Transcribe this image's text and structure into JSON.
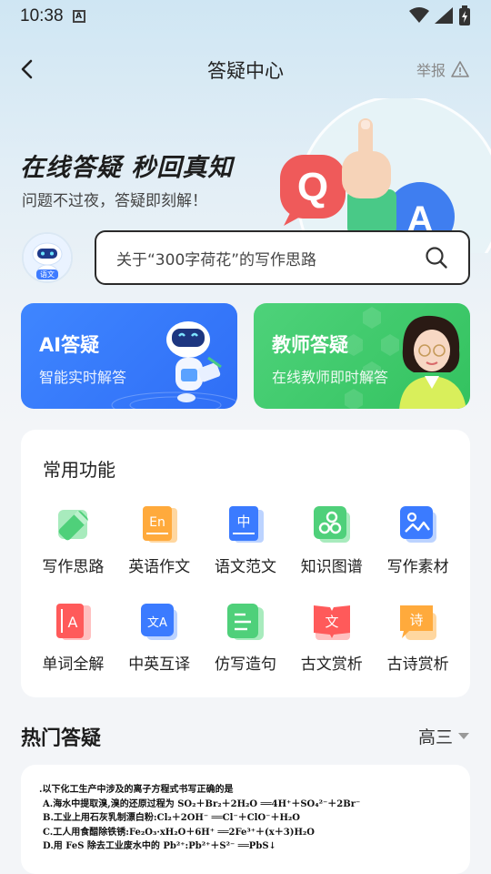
{
  "status_bar": {
    "time": "10:38",
    "notif_icon": "a-icon"
  },
  "nav": {
    "title": "答疑中心",
    "report_label": "举报"
  },
  "hero": {
    "title": "在线答疑 秒回真知",
    "subtitle": "问题不过夜，答疑即刻解！",
    "art_letters": [
      "Q",
      "A"
    ]
  },
  "avatar": {
    "tag": "语文"
  },
  "search": {
    "placeholder": "关于“300字荷花”的写作思路"
  },
  "cards": {
    "ai": {
      "title": "AI答疑",
      "subtitle": "智能实时解答",
      "color": "#3f86ff"
    },
    "teacher": {
      "title": "教师答疑",
      "subtitle": "在线教师即时解答",
      "color": "#4ed27a"
    }
  },
  "functions": {
    "title": "常用功能",
    "items": [
      {
        "label": "写作思路",
        "icon": "pencil-icon",
        "color": "#4fd07a",
        "glyph": ""
      },
      {
        "label": "英语作文",
        "icon": "english-icon",
        "color": "#ffaa3c",
        "glyph": "En"
      },
      {
        "label": "语文范文",
        "icon": "chinese-icon",
        "color": "#3b7bff",
        "glyph": "中"
      },
      {
        "label": "知识图谱",
        "icon": "graph-icon",
        "color": "#4fd07a",
        "glyph": ""
      },
      {
        "label": "写作素材",
        "icon": "image-icon",
        "color": "#3b7bff",
        "glyph": ""
      },
      {
        "label": "单词全解",
        "icon": "word-icon",
        "color": "#ff5a5a",
        "glyph": "A"
      },
      {
        "label": "中英互译",
        "icon": "translate-icon",
        "color": "#3b7bff",
        "glyph": "文A"
      },
      {
        "label": "仿写造句",
        "icon": "doc-icon",
        "color": "#4fd07a",
        "glyph": ""
      },
      {
        "label": "古文赏析",
        "icon": "book-icon",
        "color": "#ff5a5a",
        "glyph": "文"
      },
      {
        "label": "古诗赏析",
        "icon": "poem-icon",
        "color": "#ffaa3c",
        "glyph": "诗"
      }
    ]
  },
  "hot": {
    "title": "热门答疑",
    "grade": "高三"
  },
  "question": {
    "lines": [
      ".以下化工生产中涉及的离子方程式书写正确的是",
      "A.海水中提取溴,溴的还原过程为 SO₂＋Br₂＋2H₂O ══4H⁺＋SO₄²⁻＋2Br⁻",
      "B.工业上用石灰乳制漂白粉:Cl₂＋2OH⁻ ══Cl⁻＋ClO⁻＋H₂O",
      "C.工人用食醋除铁锈:Fe₂O₃·xH₂O＋6H⁺ ══2Fe³⁺＋(x＋3)H₂O",
      "D.用 FeS 除去工业废水中的 Pb²⁺:Pb²⁺＋S²⁻ ══PbS↓"
    ]
  }
}
